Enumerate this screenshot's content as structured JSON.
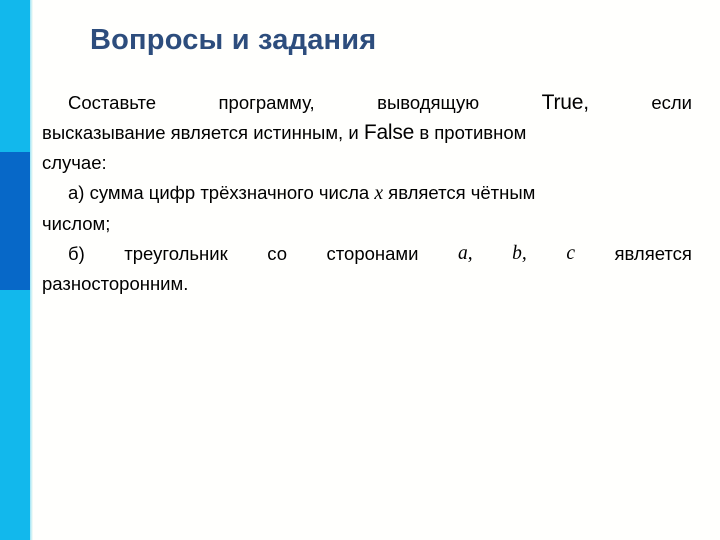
{
  "slide": {
    "title": "Вопросы и задания",
    "title_color": "#2d4d7d",
    "background_color": "#fffffd",
    "stripe": {
      "top_color": "#12b8ec",
      "middle_color": "#0768c8",
      "bottom_color": "#12b8ec"
    }
  },
  "body": {
    "paragraph1": {
      "line1": {
        "w1": "Составьте",
        "w2": "программу,",
        "w3": "выводящую",
        "w4": "True,",
        "w5": "если"
      },
      "line2": {
        "before": "высказывание является истинным, и",
        "keyword": "False",
        "after": "в противном"
      },
      "line3": "случае:"
    },
    "item_a": {
      "line1_before": "а) сумма цифр трёхзначного числа",
      "line1_var": "x",
      "line1_after": "является чётным",
      "line2": "числом;"
    },
    "item_b": {
      "line1_w1": "б)",
      "line1_w2": "треугольник",
      "line1_w3": "со",
      "line1_w4": "сторонами",
      "line1_v1": "a,",
      "line1_v2": "b,",
      "line1_v3": "c",
      "line1_w5": "является",
      "line2": "разносторонним."
    }
  }
}
